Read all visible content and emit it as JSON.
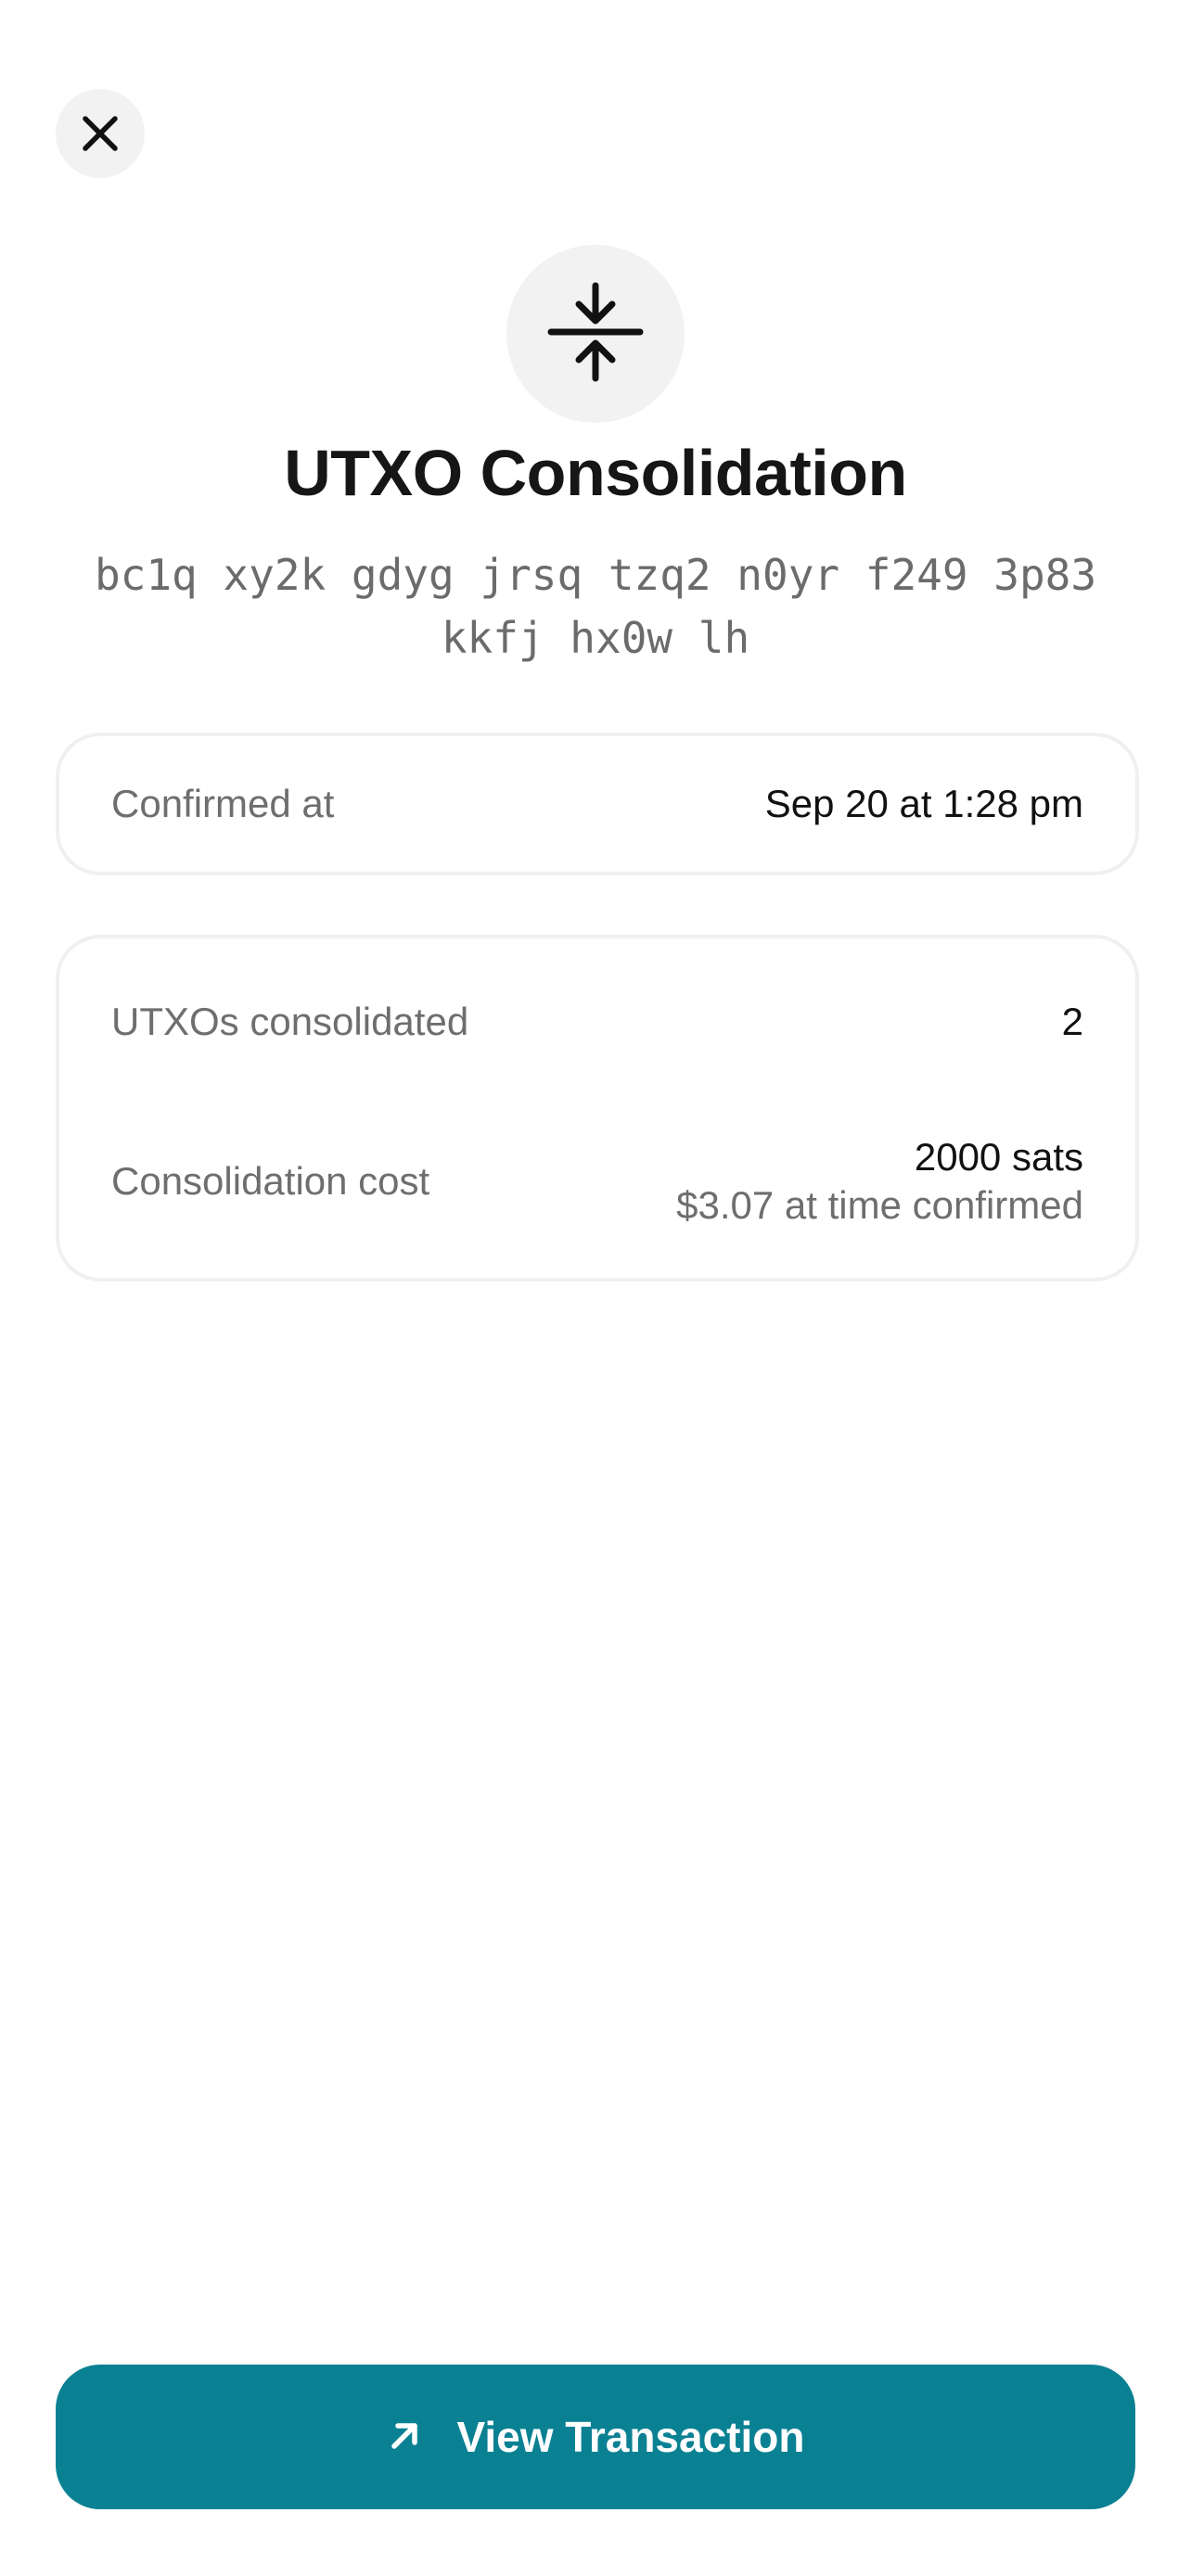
{
  "header": {
    "close_icon": "close-icon"
  },
  "hero": {
    "icon": "collapse-vertical-icon",
    "title": "UTXO Consolidation",
    "address_line1": "bc1q xy2k gdyg jrsq tzq2 n0yr f249 3p83",
    "address_line2": "kkfj hx0w lh"
  },
  "confirmation_card": {
    "label": "Confirmed at",
    "value": "Sep 20 at 1:28 pm"
  },
  "details_card": {
    "utxos_label": "UTXOs consolidated",
    "utxos_value": "2",
    "cost_label": "Consolidation cost",
    "cost_value": "2000 sats",
    "cost_fiat": "$3.07 at time confirmed"
  },
  "footer": {
    "button_label": "View Transaction",
    "button_icon": "arrow-up-right-icon"
  },
  "colors": {
    "accent": "#0a8193",
    "icon_bg": "#f2f2f2",
    "muted_text": "#6e6e6e"
  }
}
